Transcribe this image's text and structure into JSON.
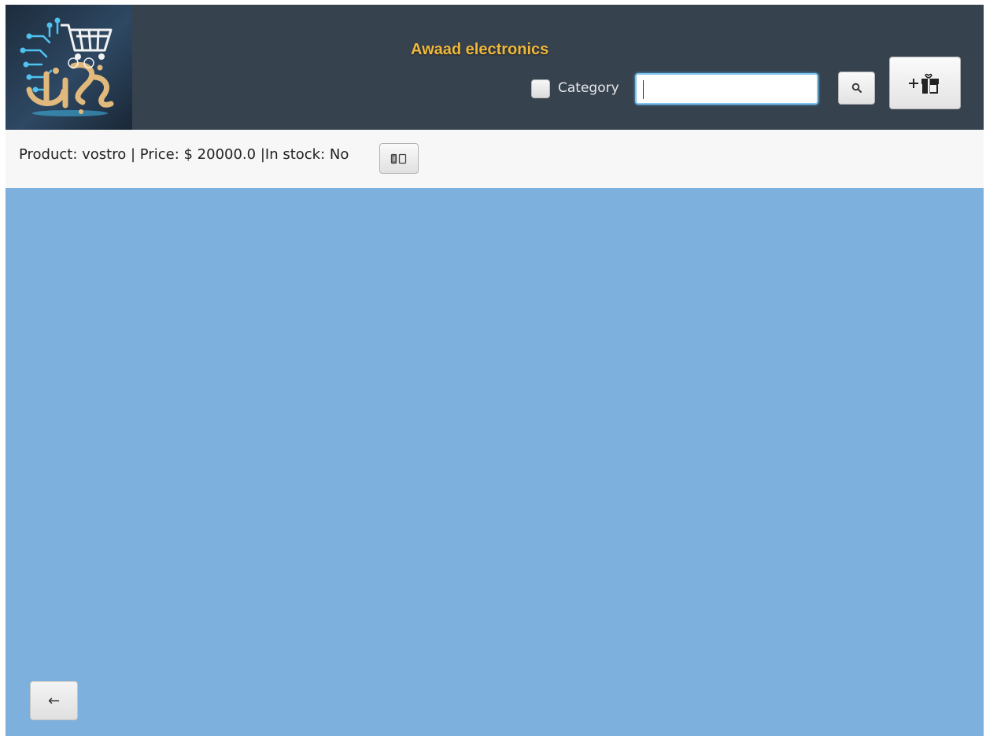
{
  "header": {
    "app_title": "Awaad electronics",
    "logo_icon": "shopping-cart-circuit-logo",
    "category_label": "Category",
    "category_checked": false,
    "search_value": "",
    "search_placeholder": "",
    "search_icon": "search-icon",
    "add_product_icon": "add-gift-box-icon"
  },
  "product_bar": {
    "product_label": "Product: ",
    "product_name": "vostro",
    "separator_1": " | ",
    "price_label": "Price: ",
    "price_value": "$ 20000.0",
    "separator_2": " |",
    "stock_label": "In stock: ",
    "stock_value": "No",
    "delete_icon": "trash-icon"
  },
  "footer": {
    "back_label": "←"
  },
  "colors": {
    "header_bg": "#37424f",
    "title": "#f0b83a",
    "main_bg": "#7db0dc",
    "product_bar_bg": "#f7f7f7",
    "input_focus": "#7fc4ee"
  }
}
